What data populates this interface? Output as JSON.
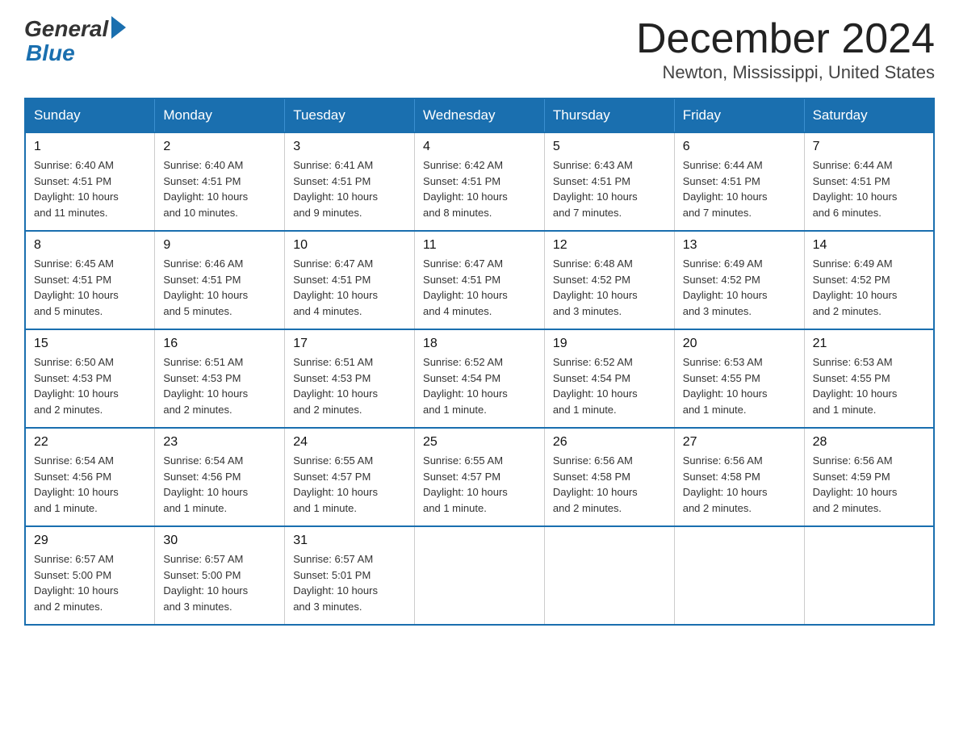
{
  "logo": {
    "text_general": "General",
    "text_blue": "Blue"
  },
  "title": "December 2024",
  "subtitle": "Newton, Mississippi, United States",
  "days_of_week": [
    "Sunday",
    "Monday",
    "Tuesday",
    "Wednesday",
    "Thursday",
    "Friday",
    "Saturday"
  ],
  "weeks": [
    [
      {
        "day": "1",
        "sunrise": "6:40 AM",
        "sunset": "4:51 PM",
        "daylight": "10 hours and 11 minutes."
      },
      {
        "day": "2",
        "sunrise": "6:40 AM",
        "sunset": "4:51 PM",
        "daylight": "10 hours and 10 minutes."
      },
      {
        "day": "3",
        "sunrise": "6:41 AM",
        "sunset": "4:51 PM",
        "daylight": "10 hours and 9 minutes."
      },
      {
        "day": "4",
        "sunrise": "6:42 AM",
        "sunset": "4:51 PM",
        "daylight": "10 hours and 8 minutes."
      },
      {
        "day": "5",
        "sunrise": "6:43 AM",
        "sunset": "4:51 PM",
        "daylight": "10 hours and 7 minutes."
      },
      {
        "day": "6",
        "sunrise": "6:44 AM",
        "sunset": "4:51 PM",
        "daylight": "10 hours and 7 minutes."
      },
      {
        "day": "7",
        "sunrise": "6:44 AM",
        "sunset": "4:51 PM",
        "daylight": "10 hours and 6 minutes."
      }
    ],
    [
      {
        "day": "8",
        "sunrise": "6:45 AM",
        "sunset": "4:51 PM",
        "daylight": "10 hours and 5 minutes."
      },
      {
        "day": "9",
        "sunrise": "6:46 AM",
        "sunset": "4:51 PM",
        "daylight": "10 hours and 5 minutes."
      },
      {
        "day": "10",
        "sunrise": "6:47 AM",
        "sunset": "4:51 PM",
        "daylight": "10 hours and 4 minutes."
      },
      {
        "day": "11",
        "sunrise": "6:47 AM",
        "sunset": "4:51 PM",
        "daylight": "10 hours and 4 minutes."
      },
      {
        "day": "12",
        "sunrise": "6:48 AM",
        "sunset": "4:52 PM",
        "daylight": "10 hours and 3 minutes."
      },
      {
        "day": "13",
        "sunrise": "6:49 AM",
        "sunset": "4:52 PM",
        "daylight": "10 hours and 3 minutes."
      },
      {
        "day": "14",
        "sunrise": "6:49 AM",
        "sunset": "4:52 PM",
        "daylight": "10 hours and 2 minutes."
      }
    ],
    [
      {
        "day": "15",
        "sunrise": "6:50 AM",
        "sunset": "4:53 PM",
        "daylight": "10 hours and 2 minutes."
      },
      {
        "day": "16",
        "sunrise": "6:51 AM",
        "sunset": "4:53 PM",
        "daylight": "10 hours and 2 minutes."
      },
      {
        "day": "17",
        "sunrise": "6:51 AM",
        "sunset": "4:53 PM",
        "daylight": "10 hours and 2 minutes."
      },
      {
        "day": "18",
        "sunrise": "6:52 AM",
        "sunset": "4:54 PM",
        "daylight": "10 hours and 1 minute."
      },
      {
        "day": "19",
        "sunrise": "6:52 AM",
        "sunset": "4:54 PM",
        "daylight": "10 hours and 1 minute."
      },
      {
        "day": "20",
        "sunrise": "6:53 AM",
        "sunset": "4:55 PM",
        "daylight": "10 hours and 1 minute."
      },
      {
        "day": "21",
        "sunrise": "6:53 AM",
        "sunset": "4:55 PM",
        "daylight": "10 hours and 1 minute."
      }
    ],
    [
      {
        "day": "22",
        "sunrise": "6:54 AM",
        "sunset": "4:56 PM",
        "daylight": "10 hours and 1 minute."
      },
      {
        "day": "23",
        "sunrise": "6:54 AM",
        "sunset": "4:56 PM",
        "daylight": "10 hours and 1 minute."
      },
      {
        "day": "24",
        "sunrise": "6:55 AM",
        "sunset": "4:57 PM",
        "daylight": "10 hours and 1 minute."
      },
      {
        "day": "25",
        "sunrise": "6:55 AM",
        "sunset": "4:57 PM",
        "daylight": "10 hours and 1 minute."
      },
      {
        "day": "26",
        "sunrise": "6:56 AM",
        "sunset": "4:58 PM",
        "daylight": "10 hours and 2 minutes."
      },
      {
        "day": "27",
        "sunrise": "6:56 AM",
        "sunset": "4:58 PM",
        "daylight": "10 hours and 2 minutes."
      },
      {
        "day": "28",
        "sunrise": "6:56 AM",
        "sunset": "4:59 PM",
        "daylight": "10 hours and 2 minutes."
      }
    ],
    [
      {
        "day": "29",
        "sunrise": "6:57 AM",
        "sunset": "5:00 PM",
        "daylight": "10 hours and 2 minutes."
      },
      {
        "day": "30",
        "sunrise": "6:57 AM",
        "sunset": "5:00 PM",
        "daylight": "10 hours and 3 minutes."
      },
      {
        "day": "31",
        "sunrise": "6:57 AM",
        "sunset": "5:01 PM",
        "daylight": "10 hours and 3 minutes."
      },
      null,
      null,
      null,
      null
    ]
  ],
  "cell_labels": {
    "sunrise": "Sunrise:",
    "sunset": "Sunset:",
    "daylight": "Daylight:"
  }
}
